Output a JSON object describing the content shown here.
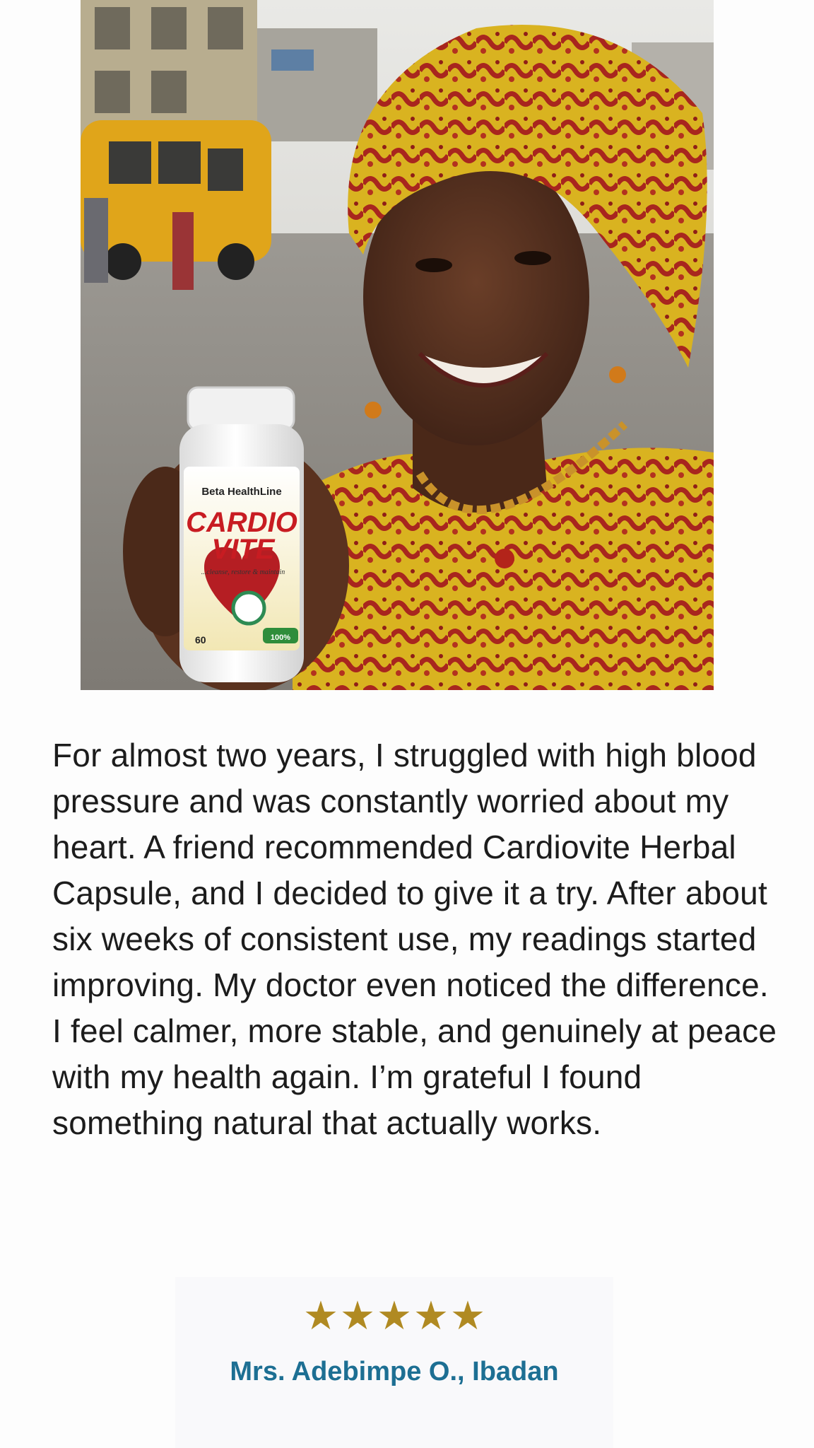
{
  "photo": {
    "product": {
      "brand": "Beta HealthLine",
      "name_line1": "CARDIO",
      "name_line2": "VITE",
      "tagline": "...cleanse, restore & maintain",
      "count": "60",
      "badge": "100%"
    }
  },
  "testimonial": {
    "text": "For almost two years, I struggled with high blood pressure and was constantly worried about my heart. A friend recommended Cardiovite Herbal Capsule, and I decided to give it a try. After about six weeks of consistent use, my readings started improving. My doctor even noticed the difference. I feel calmer, more stable, and genuinely at peace with my health again. I’m grateful I found something natural that actually works."
  },
  "review": {
    "rating": 5,
    "star_glyph": "★",
    "star_color": "#b08a22",
    "reviewer": "Mrs. Adebimpe O., Ibadan",
    "reviewer_color": "#1d6f93"
  }
}
